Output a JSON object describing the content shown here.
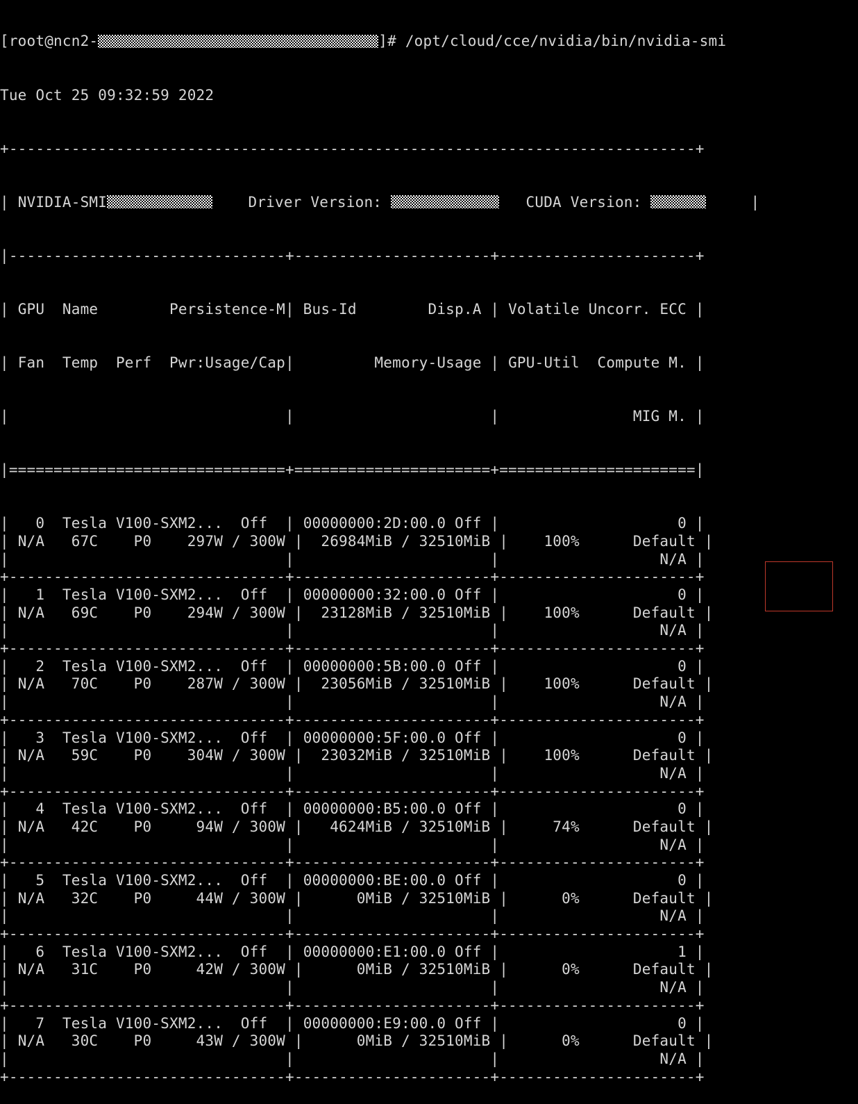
{
  "prompt": {
    "user_host_prefix": "[root@ncn2-",
    "user_host_suffix": "]# ",
    "command": "/opt/cloud/cce/nvidia/bin/nvidia-smi"
  },
  "timestamp": "Tue Oct 25 09:32:59 2022",
  "header": {
    "smi_label": "NVIDIA-SMI",
    "driver_label": "Driver Version:",
    "cuda_label": "CUDA Version:"
  },
  "columns": {
    "row1_left": "GPU  Name        Persistence-M",
    "row1_mid": "Bus-Id        Disp.A",
    "row1_right": "Volatile Uncorr. ECC",
    "row2_left": "Fan  Temp  Perf  Pwr:Usage/Cap",
    "row2_mid": "Memory-Usage",
    "row2_right": "GPU-Util  Compute M.",
    "row3_right": "MIG M."
  },
  "gpus": [
    {
      "index": "0",
      "name": "Tesla V100-SXM2...",
      "persistence": "Off",
      "fan": "N/A",
      "temp": "67C",
      "perf": "P0",
      "power": "297W / 300W",
      "bus_id": "00000000:2D:00.0",
      "disp": "Off",
      "memory": "26984MiB / 32510MiB",
      "util": "100%",
      "ecc": "0",
      "compute": "Default",
      "mig": "N/A"
    },
    {
      "index": "1",
      "name": "Tesla V100-SXM2...",
      "persistence": "Off",
      "fan": "N/A",
      "temp": "69C",
      "perf": "P0",
      "power": "294W / 300W",
      "bus_id": "00000000:32:00.0",
      "disp": "Off",
      "memory": "23128MiB / 32510MiB",
      "util": "100%",
      "ecc": "0",
      "compute": "Default",
      "mig": "N/A"
    },
    {
      "index": "2",
      "name": "Tesla V100-SXM2...",
      "persistence": "Off",
      "fan": "N/A",
      "temp": "70C",
      "perf": "P0",
      "power": "287W / 300W",
      "bus_id": "00000000:5B:00.0",
      "disp": "Off",
      "memory": "23056MiB / 32510MiB",
      "util": "100%",
      "ecc": "0",
      "compute": "Default",
      "mig": "N/A"
    },
    {
      "index": "3",
      "name": "Tesla V100-SXM2...",
      "persistence": "Off",
      "fan": "N/A",
      "temp": "59C",
      "perf": "P0",
      "power": "304W / 300W",
      "bus_id": "00000000:5F:00.0",
      "disp": "Off",
      "memory": "23032MiB / 32510MiB",
      "util": "100%",
      "ecc": "0",
      "compute": "Default",
      "mig": "N/A"
    },
    {
      "index": "4",
      "name": "Tesla V100-SXM2...",
      "persistence": "Off",
      "fan": "N/A",
      "temp": "42C",
      "perf": "P0",
      "power": "94W / 300W",
      "bus_id": "00000000:B5:00.0",
      "disp": "Off",
      "memory": "4624MiB / 32510MiB",
      "util": "74%",
      "ecc": "0",
      "compute": "Default",
      "mig": "N/A"
    },
    {
      "index": "5",
      "name": "Tesla V100-SXM2...",
      "persistence": "Off",
      "fan": "N/A",
      "temp": "32C",
      "perf": "P0",
      "power": "44W / 300W",
      "bus_id": "00000000:BE:00.0",
      "disp": "Off",
      "memory": "0MiB / 32510MiB",
      "util": "0%",
      "ecc": "0",
      "compute": "Default",
      "mig": "N/A"
    },
    {
      "index": "6",
      "name": "Tesla V100-SXM2...",
      "persistence": "Off",
      "fan": "N/A",
      "temp": "31C",
      "perf": "P0",
      "power": "42W / 300W",
      "bus_id": "00000000:E1:00.0",
      "disp": "Off",
      "memory": "0MiB / 32510MiB",
      "util": "0%",
      "ecc": "1",
      "compute": "Default",
      "mig": "N/A"
    },
    {
      "index": "7",
      "name": "Tesla V100-SXM2...",
      "persistence": "Off",
      "fan": "N/A",
      "temp": "30C",
      "perf": "P0",
      "power": "43W / 300W",
      "bus_id": "00000000:E9:00.0",
      "disp": "Off",
      "memory": "0MiB / 32510MiB",
      "util": "0%",
      "ecc": "0",
      "compute": "Default",
      "mig": "N/A"
    }
  ],
  "colors": {
    "background": "#000000",
    "text": "#d6d6d6",
    "highlight_box": "#c0392b"
  }
}
